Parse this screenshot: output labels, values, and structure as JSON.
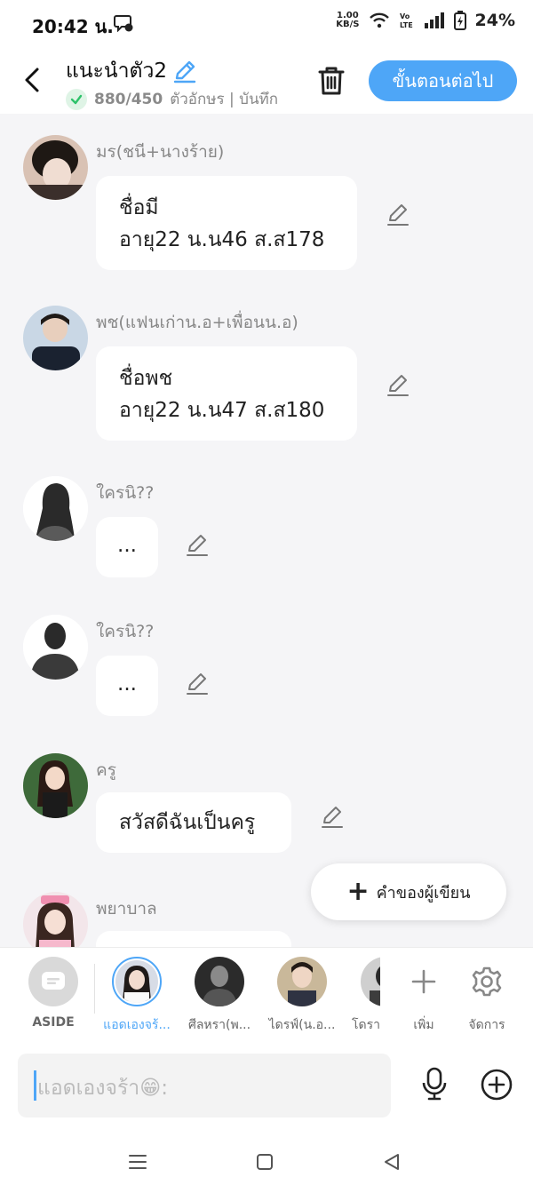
{
  "status_bar": {
    "time": "20:42 น.",
    "net_speed_value": "1.00",
    "net_speed_unit": "KB/S",
    "battery": "24%"
  },
  "header": {
    "title": "แนะนำตัว2",
    "char_count": "880/450",
    "char_count_label": "ตัวอักษร | บันทึก",
    "next_button": "ขั้นตอนต่อไป"
  },
  "messages": [
    {
      "sender": "มร(ชนี+นางร้าย)",
      "text": "ชื่อมี\nอายุ22 น.น46 ส.ส178"
    },
    {
      "sender": "พช(แฟนเก่าน.อ+เพื่อนน.อ)",
      "text": "ชื่อพช\nอายุ22 น.น47 ส.ส180"
    },
    {
      "sender": "ใครนิ??",
      "text": "..."
    },
    {
      "sender": "ใครนิ??",
      "text": "..."
    },
    {
      "sender": "ครู",
      "text": "สวัสดีฉันเป็นครู"
    },
    {
      "sender": "พยาบาล",
      "text": ""
    }
  ],
  "author_button": "คำของผู้เขียน",
  "characters": [
    {
      "label": "ASIDE"
    },
    {
      "label": "แอดเองจร้..."
    },
    {
      "label": "ศีลหรา(พ..."
    },
    {
      "label": "ไดรฟ์(น.อ..."
    },
    {
      "label": "โดรา"
    },
    {
      "label": "เพิ่ม"
    },
    {
      "label": "จัดการ"
    }
  ],
  "input": {
    "placeholder": "แอดเองจร้า😁:"
  },
  "colors": {
    "accent": "#4ea6f7",
    "background": "#f5f5f7",
    "success": "#2ec26a"
  }
}
